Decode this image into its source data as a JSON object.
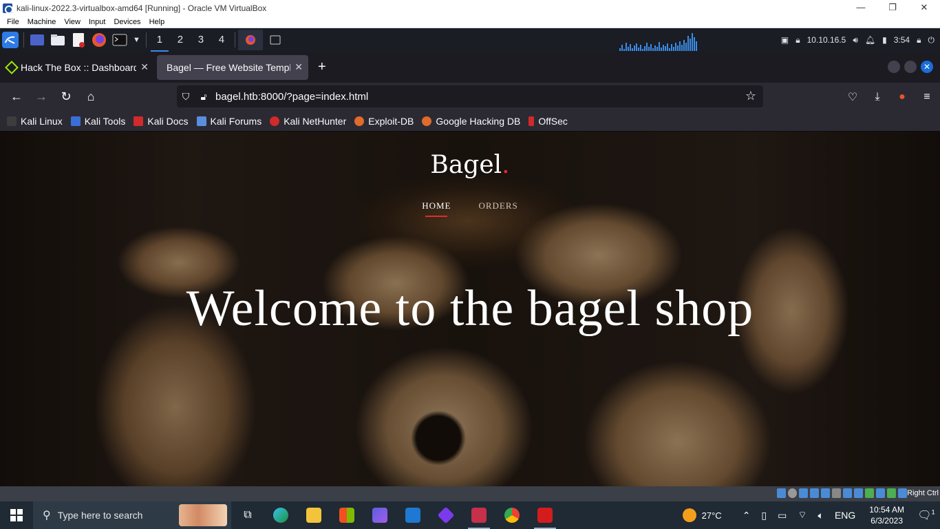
{
  "vbox": {
    "window_title": "kali-linux-2022.3-virtualbox-amd64 [Running] - Oracle VM VirtualBox",
    "controls": {
      "minimize": "—",
      "restore": "❐",
      "close": "✕"
    },
    "menu": [
      "File",
      "Machine",
      "View",
      "Input",
      "Devices",
      "Help"
    ],
    "status_right": "Right Ctrl"
  },
  "kali_panel": {
    "workspaces": [
      "1",
      "2",
      "3",
      "4"
    ],
    "active_workspace": "1",
    "ip": "10.10.16.5",
    "time": "3:54"
  },
  "browser": {
    "tabs": [
      {
        "title": "Hack The Box :: Dashboard",
        "active": false
      },
      {
        "title": "Bagel — Free Website Template",
        "active": true
      }
    ],
    "url": "bagel.htb:8000/?page=index.html",
    "bookmarks": [
      {
        "label": "Kali Linux",
        "color": "#3d3d3d"
      },
      {
        "label": "Kali Tools",
        "color": "#3b6fd8"
      },
      {
        "label": "Kali Docs",
        "color": "#d12a2a"
      },
      {
        "label": "Kali Forums",
        "color": "#5a8fe0"
      },
      {
        "label": "Kali NetHunter",
        "color": "#d12a2a"
      },
      {
        "label": "Exploit-DB",
        "color": "#e06b2b"
      },
      {
        "label": "Google Hacking DB",
        "color": "#e06b2b"
      },
      {
        "label": "OffSec",
        "color": "#d12a2a"
      }
    ]
  },
  "site": {
    "logo_text": "Bagel",
    "logo_dot": ".",
    "nav": [
      {
        "label": "HOME",
        "active": true
      },
      {
        "label": "ORDERS",
        "active": false
      }
    ],
    "hero_title": "Welcome to the bagel shop"
  },
  "windows": {
    "search_placeholder": "Type here to search",
    "temperature": "27°C",
    "language": "ENG",
    "time": "10:54 AM",
    "date": "6/3/2023",
    "notification_count": "1"
  }
}
